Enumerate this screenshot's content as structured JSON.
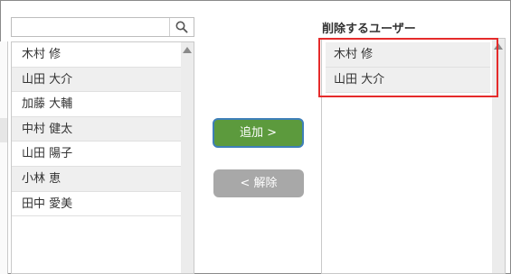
{
  "search": {
    "placeholder": "",
    "value": ""
  },
  "available_users": [
    "木村 修",
    "山田 大介",
    "加藤 大輔",
    "中村 健太",
    "山田 陽子",
    "小林 恵",
    "田中 愛美"
  ],
  "remove_panel": {
    "title": "削除するユーザー",
    "users": [
      "木村 修",
      "山田 大介"
    ]
  },
  "buttons": {
    "add_label": "追加 >",
    "remove_label": "< 解除"
  },
  "colors": {
    "add_button": "#5c9a3d",
    "remove_button": "#a8a8a8",
    "highlight": "#e52b2b"
  }
}
